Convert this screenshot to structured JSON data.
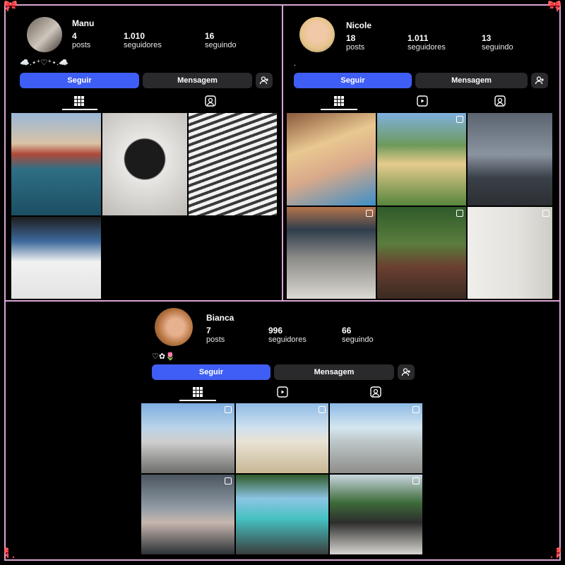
{
  "profiles": {
    "manu": {
      "username": "Manu",
      "posts_count": "4",
      "posts_label": "posts",
      "followers_count": "1.010",
      "followers_label": "seguidores",
      "following_count": "16",
      "following_label": "seguindo",
      "bio": "☁️.⋆⁺♡⁺⋆.☁️",
      "follow_label": "Seguir",
      "message_label": "Mensagem"
    },
    "nicole": {
      "username": "Nicole",
      "posts_count": "18",
      "posts_label": "posts",
      "followers_count": "1.011",
      "followers_label": "seguidores",
      "following_count": "13",
      "following_label": "seguindo",
      "bio": ".",
      "follow_label": "Seguir",
      "message_label": "Mensagem"
    },
    "bianca": {
      "username": "Bianca",
      "posts_count": "7",
      "posts_label": "posts",
      "followers_count": "996",
      "followers_label": "seguidores",
      "following_count": "66",
      "following_label": "seguindo",
      "bio": "♡✿🌷",
      "follow_label": "Seguir",
      "message_label": "Mensagem"
    }
  },
  "colors": {
    "follow_button": "#3f5ef5",
    "message_button": "#2a2a2d",
    "frame": "#d9a6d2"
  },
  "icons": [
    "grid-icon",
    "reels-icon",
    "tagged-icon",
    "add-person-icon",
    "multi-post-icon",
    "bow-icon"
  ]
}
